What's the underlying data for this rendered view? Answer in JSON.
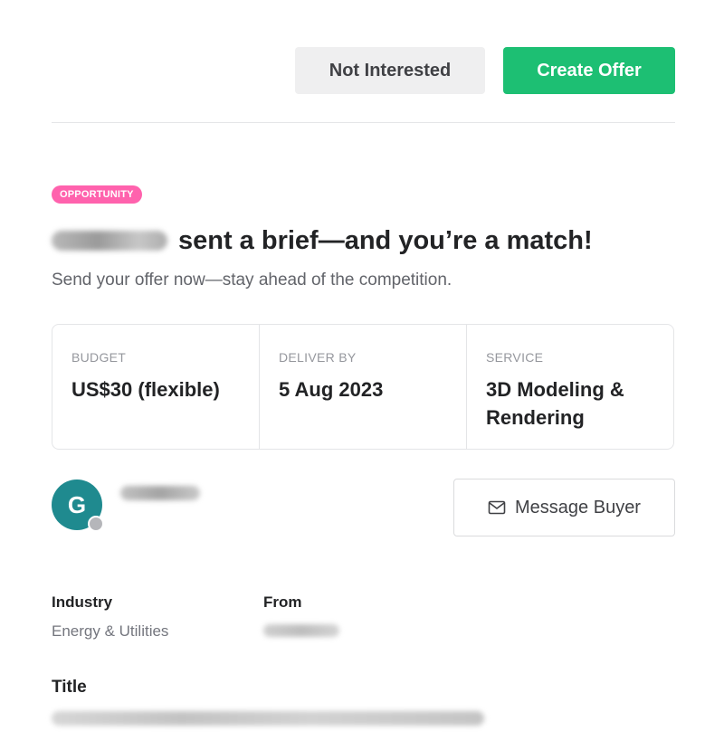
{
  "actions": {
    "not_interested_label": "Not Interested",
    "create_offer_label": "Create Offer"
  },
  "brief": {
    "badge": "OPPORTUNITY",
    "headline": "sent a brief—and you’re a match!",
    "subtitle": "Send your offer now—stay ahead of the competition.",
    "details": [
      {
        "label": "BUDGET",
        "value": "US$30 (flexible)"
      },
      {
        "label": "DELIVER BY",
        "value": "5 Aug 2023"
      },
      {
        "label": "SERVICE",
        "value": "3D Modeling & Rendering"
      }
    ]
  },
  "buyer": {
    "avatar_initial": "G",
    "message_label": "Message Buyer"
  },
  "info": {
    "industry_label": "Industry",
    "industry_value": "Energy & Utilities",
    "from_label": "From",
    "title_label": "Title"
  },
  "colors": {
    "primary": "#1dbf73",
    "badge": "#ff62ad",
    "avatar": "#1f8a8f"
  }
}
